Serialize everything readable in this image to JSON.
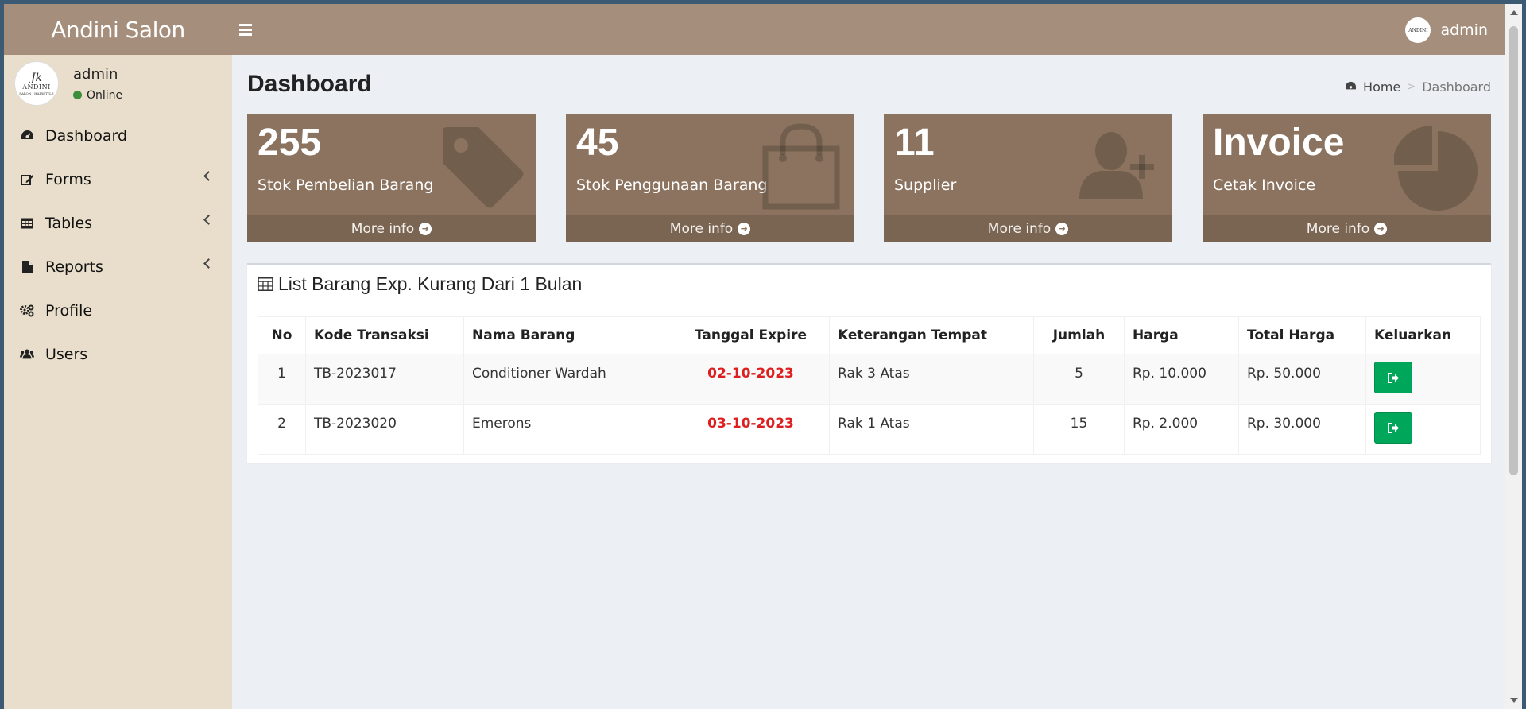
{
  "app": {
    "title": "Andini Salon",
    "header_user": "admin",
    "avatar_text": {
      "sig": "Jk",
      "brand": "ANDINI",
      "sub": "SALON · HAIRSTYLE"
    }
  },
  "sidebar": {
    "user_name": "admin",
    "user_status": "Online",
    "items": [
      {
        "label": "Dashboard",
        "icon": "dashboard-icon",
        "has_children": false
      },
      {
        "label": "Forms",
        "icon": "edit-icon",
        "has_children": true
      },
      {
        "label": "Tables",
        "icon": "table-icon",
        "has_children": true
      },
      {
        "label": "Reports",
        "icon": "file-icon",
        "has_children": true
      },
      {
        "label": "Profile",
        "icon": "gears-icon",
        "has_children": false
      },
      {
        "label": "Users",
        "icon": "users-icon",
        "has_children": false
      }
    ]
  },
  "page": {
    "title": "Dashboard",
    "breadcrumb": {
      "home": "Home",
      "current": "Dashboard"
    }
  },
  "boxes": [
    {
      "value": "255",
      "label": "Stok Pembelian Barang",
      "more": "More info",
      "icon": "tag-icon"
    },
    {
      "value": "45",
      "label": "Stok Penggunaan Barang",
      "more": "More info",
      "icon": "shopping-bag-icon"
    },
    {
      "value": "11",
      "label": "Supplier",
      "more": "More info",
      "icon": "user-plus-icon"
    },
    {
      "value": "Invoice",
      "label": "Cetak Invoice",
      "more": "More info",
      "icon": "pie-chart-icon"
    }
  ],
  "panel": {
    "title": "List Barang Exp. Kurang Dari 1 Bulan",
    "columns": [
      "No",
      "Kode Transaksi",
      "Nama Barang",
      "Tanggal Expire",
      "Keterangan Tempat",
      "Jumlah",
      "Harga",
      "Total Harga",
      "Keluarkan"
    ],
    "rows": [
      {
        "no": "1",
        "kode": "TB-2023017",
        "nama": "Conditioner Wardah",
        "expire": "02-10-2023",
        "tempat": "Rak 3 Atas",
        "jumlah": "5",
        "harga": "Rp. 10.000",
        "total": "Rp. 50.000"
      },
      {
        "no": "2",
        "kode": "TB-2023020",
        "nama": "Emerons",
        "expire": "03-10-2023",
        "tempat": "Rak 1 Atas",
        "jumlah": "15",
        "harga": "Rp. 2.000",
        "total": "Rp. 30.000"
      }
    ]
  },
  "colors": {
    "header": "#a58f7c",
    "sidebar": "#e9decb",
    "box": "#8b735f",
    "expire": "#dd1f1f",
    "action_button": "#00a65a"
  }
}
